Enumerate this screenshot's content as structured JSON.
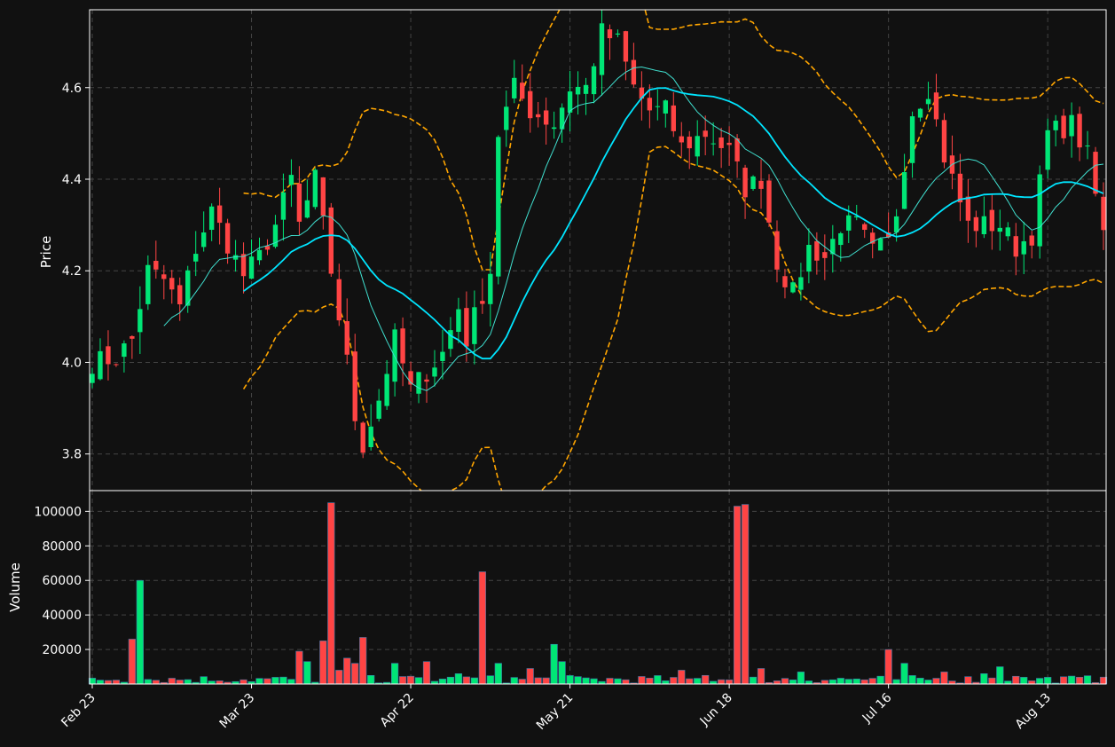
{
  "chart_data": {
    "type": "candlestick",
    "colors": {
      "background": "#111111",
      "up": "#00e676",
      "down": "#ff4444",
      "ma_fast": "#40e0d0",
      "ma_slow": "#00e5ff",
      "bands": "#ffa500",
      "grid": "#444444",
      "axis": "#ffffff"
    },
    "price_panel": {
      "ylabel": "Price",
      "ylim": [
        3.72,
        4.77
      ],
      "yticks": [
        3.8,
        4.0,
        4.2,
        4.4,
        4.6
      ],
      "ytick_labels": [
        "3.8",
        "4.0",
        "4.2",
        "4.4",
        "4.6"
      ]
    },
    "volume_panel": {
      "ylabel": "Volume",
      "ylim": [
        0,
        112000
      ],
      "yticks": [
        20000,
        40000,
        60000,
        80000,
        100000
      ],
      "ytick_labels": [
        "20000",
        "40000",
        "60000",
        "80000",
        "100000"
      ]
    },
    "x_axis": {
      "n_bars": 128,
      "tick_index": [
        0,
        20,
        40,
        60,
        80,
        100,
        120
      ],
      "tick_labels": [
        "Feb 23",
        "Mar 23",
        "Apr 22",
        "May 21",
        "Jun 18",
        "Jul 16",
        "Aug 13"
      ]
    },
    "anchors": [
      [
        0,
        4.0
      ],
      [
        3,
        4.01
      ],
      [
        5,
        4.05
      ],
      [
        7,
        4.2
      ],
      [
        9,
        4.18
      ],
      [
        11,
        4.12
      ],
      [
        13,
        4.25
      ],
      [
        15,
        4.33
      ],
      [
        17,
        4.26
      ],
      [
        19,
        4.19
      ],
      [
        21,
        4.23
      ],
      [
        23,
        4.3
      ],
      [
        25,
        4.4
      ],
      [
        26,
        4.3
      ],
      [
        28,
        4.4
      ],
      [
        30,
        4.2
      ],
      [
        32,
        4.0
      ],
      [
        33,
        3.88
      ],
      [
        34,
        3.82
      ],
      [
        36,
        3.92
      ],
      [
        38,
        4.05
      ],
      [
        40,
        3.94
      ],
      [
        42,
        3.98
      ],
      [
        44,
        4.02
      ],
      [
        46,
        4.12
      ],
      [
        47,
        4.05
      ],
      [
        50,
        4.2
      ],
      [
        51,
        4.5
      ],
      [
        53,
        4.6
      ],
      [
        55,
        4.55
      ],
      [
        58,
        4.52
      ],
      [
        60,
        4.6
      ],
      [
        62,
        4.6
      ],
      [
        64,
        4.72
      ],
      [
        66,
        4.7
      ],
      [
        68,
        4.6
      ],
      [
        70,
        4.55
      ],
      [
        72,
        4.55
      ],
      [
        74,
        4.47
      ],
      [
        77,
        4.5
      ],
      [
        80,
        4.46
      ],
      [
        82,
        4.38
      ],
      [
        84,
        4.4
      ],
      [
        86,
        4.22
      ],
      [
        88,
        4.15
      ],
      [
        90,
        4.25
      ],
      [
        92,
        4.23
      ],
      [
        94,
        4.3
      ],
      [
        96,
        4.3
      ],
      [
        98,
        4.24
      ],
      [
        100,
        4.26
      ],
      [
        101,
        4.33
      ],
      [
        103,
        4.55
      ],
      [
        105,
        4.6
      ],
      [
        107,
        4.45
      ],
      [
        110,
        4.3
      ],
      [
        112,
        4.3
      ],
      [
        114,
        4.3
      ],
      [
        116,
        4.25
      ],
      [
        118,
        4.28
      ],
      [
        120,
        4.5
      ],
      [
        123,
        4.52
      ],
      [
        125,
        4.45
      ],
      [
        127,
        4.28
      ]
    ],
    "volume_spikes": [
      [
        5,
        26000
      ],
      [
        6,
        60000
      ],
      [
        26,
        19000
      ],
      [
        27,
        13000
      ],
      [
        29,
        25000
      ],
      [
        30,
        105000
      ],
      [
        31,
        8000
      ],
      [
        32,
        15000
      ],
      [
        33,
        12000
      ],
      [
        34,
        27000
      ],
      [
        38,
        12000
      ],
      [
        42,
        13000
      ],
      [
        46,
        6000
      ],
      [
        49,
        65000
      ],
      [
        51,
        12000
      ],
      [
        55,
        9000
      ],
      [
        58,
        23000
      ],
      [
        59,
        13000
      ],
      [
        74,
        8000
      ],
      [
        77,
        5000
      ],
      [
        81,
        103000
      ],
      [
        82,
        104000
      ],
      [
        84,
        9000
      ],
      [
        89,
        7000
      ],
      [
        100,
        20000
      ],
      [
        102,
        12000
      ],
      [
        107,
        7000
      ],
      [
        112,
        6000
      ],
      [
        114,
        10000
      ],
      [
        116,
        4500
      ],
      [
        127,
        4000
      ]
    ]
  }
}
